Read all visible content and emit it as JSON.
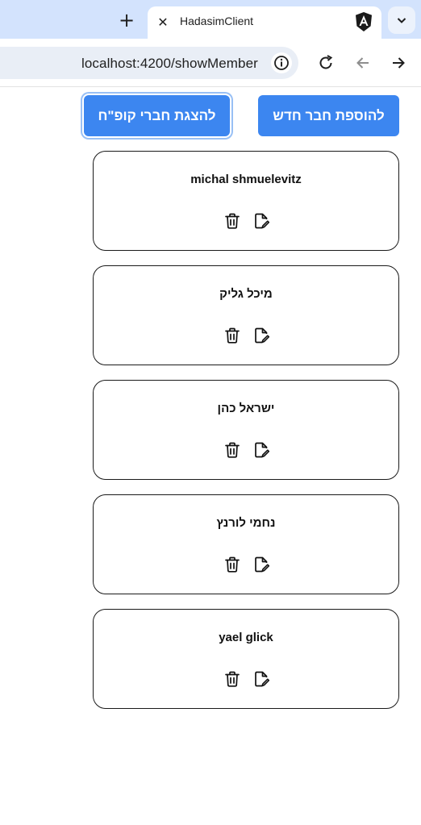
{
  "browser": {
    "tab_title": "HadasimClient",
    "new_tab_symbol": "+",
    "close_symbol": "✕",
    "url": "localhost:4200/showMember",
    "icons": [
      "plus-icon",
      "close-icon",
      "angular-logo-icon",
      "chevron-down-icon",
      "info-icon",
      "reload-icon",
      "back-arrow-icon",
      "forward-arrow-icon"
    ]
  },
  "actions": {
    "show_members_label": "להצגת חברי קופ\"ח",
    "add_member_label": "להוספת חבר חדש"
  },
  "members": [
    {
      "name": "michal shmuelevitz"
    },
    {
      "name": "מיכל גליק"
    },
    {
      "name": "ישראל כהן"
    },
    {
      "name": "נחמי לורנץ"
    },
    {
      "name": "yael glick"
    }
  ],
  "colors": {
    "primary_button": "#3c86f0",
    "tab_strip": "#d3e3fd",
    "card_border": "#1a1a1a"
  }
}
